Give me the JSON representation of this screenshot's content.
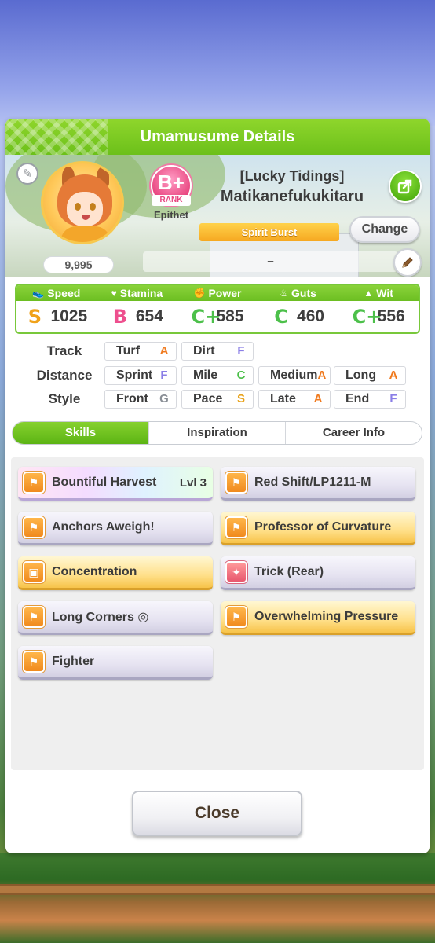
{
  "dialog": {
    "title": "Umamusume Details",
    "close_label": "Close"
  },
  "profile": {
    "fans": "9,995",
    "rank_grade": "B+",
    "rank_label": "RANK",
    "epithet_label": "Epithet",
    "title": "[Lucky Tidings]",
    "name": "Matikanefukukitaru",
    "epithet_banner": "Spirit Burst",
    "change_label": "Change",
    "memo": "–"
  },
  "stats": [
    {
      "name": "Speed",
      "icon": "shoe-icon",
      "grade": "S",
      "value": "1025",
      "color": "#f0a21a"
    },
    {
      "name": "Stamina",
      "icon": "heart-icon",
      "grade": "B",
      "value": "654",
      "color": "#ee4f8e"
    },
    {
      "name": "Power",
      "icon": "muscle-icon",
      "grade": "C+",
      "value": "585",
      "color": "#4cc04a"
    },
    {
      "name": "Guts",
      "icon": "flame-icon",
      "grade": "C",
      "value": "460",
      "color": "#4cc04a"
    },
    {
      "name": "Wit",
      "icon": "cap-icon",
      "grade": "C+",
      "value": "556",
      "color": "#4cc04a"
    }
  ],
  "aptitude": {
    "track_label": "Track",
    "distance_label": "Distance",
    "style_label": "Style",
    "track": [
      {
        "name": "Turf",
        "grade": "A",
        "color": "#f07a1e"
      },
      {
        "name": "Dirt",
        "grade": "F",
        "color": "#8a7ee6"
      }
    ],
    "distance": [
      {
        "name": "Sprint",
        "grade": "F",
        "color": "#8a7ee6"
      },
      {
        "name": "Mile",
        "grade": "C",
        "color": "#4cc04a"
      },
      {
        "name": "Medium",
        "grade": "A",
        "color": "#f07a1e"
      },
      {
        "name": "Long",
        "grade": "A",
        "color": "#f07a1e"
      }
    ],
    "style": [
      {
        "name": "Front",
        "grade": "G",
        "color": "#8a8f96"
      },
      {
        "name": "Pace",
        "grade": "S",
        "color": "#e8a21a"
      },
      {
        "name": "Late",
        "grade": "A",
        "color": "#f07a1e"
      },
      {
        "name": "End",
        "grade": "F",
        "color": "#8a7ee6"
      }
    ]
  },
  "tabs": [
    {
      "label": "Skills",
      "active": true
    },
    {
      "label": "Inspiration",
      "active": false
    },
    {
      "label": "Career Info",
      "active": false
    }
  ],
  "skills": [
    {
      "name": "Bountiful Harvest",
      "level": "Lvl 3",
      "style": "rainbow",
      "icon": "running-icon"
    },
    {
      "name": "Red Shift/LP1211-M",
      "level": "",
      "style": "white",
      "icon": "running-icon"
    },
    {
      "name": "Anchors Aweigh!",
      "level": "",
      "style": "white",
      "icon": "running-icon"
    },
    {
      "name": "Professor of Curvature",
      "level": "",
      "style": "gold",
      "icon": "running-icon"
    },
    {
      "name": "Concentration",
      "level": "",
      "style": "gold",
      "icon": "gate-icon"
    },
    {
      "name": "Trick (Rear)",
      "level": "",
      "style": "white",
      "icon": "sparkle-icon"
    },
    {
      "name": "Long Corners ◎",
      "level": "",
      "style": "white",
      "icon": "running-icon"
    },
    {
      "name": "Overwhelming Pressure",
      "level": "",
      "style": "gold",
      "icon": "running-icon"
    },
    {
      "name": "Fighter",
      "level": "",
      "style": "white",
      "icon": "running-icon"
    }
  ]
}
